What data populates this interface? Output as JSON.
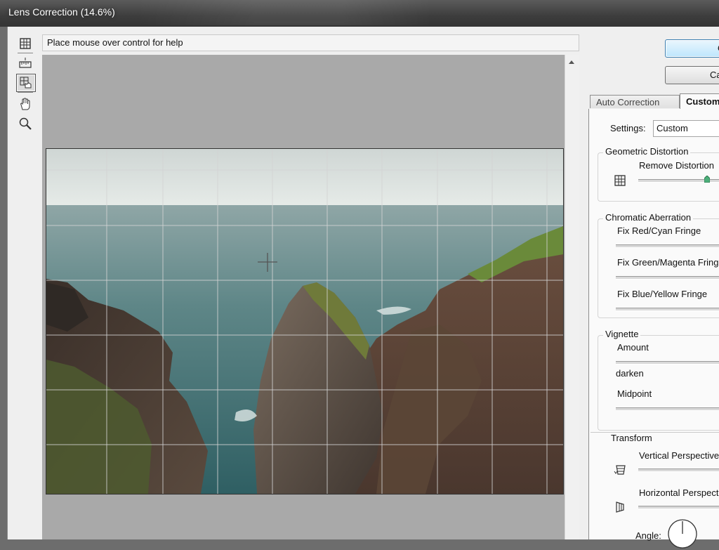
{
  "window": {
    "title": "Lens Correction (14.6%)"
  },
  "help": {
    "text": "Place mouse over control for help"
  },
  "tools": [
    {
      "name": "remove-distortion-tool-icon"
    },
    {
      "name": "straighten-tool-icon"
    },
    {
      "name": "move-grid-tool-icon",
      "selected": true
    },
    {
      "name": "hand-tool-icon"
    },
    {
      "name": "zoom-tool-icon"
    }
  ],
  "buttons": {
    "ok": "O",
    "cancel": "Ca"
  },
  "tabs": {
    "auto": "Auto Correction",
    "custom": "Custom"
  },
  "settings": {
    "label": "Settings:",
    "value": "Custom"
  },
  "geometric": {
    "legend": "Geometric Distortion",
    "remove_label": "Remove Distortion"
  },
  "chromatic": {
    "legend": "Chromatic Aberration",
    "red_cyan": "Fix Red/Cyan Fringe",
    "green_magenta": "Fix Green/Magenta Fringe",
    "blue_yellow": "Fix Blue/Yellow Fringe"
  },
  "vignette": {
    "legend": "Vignette",
    "amount": "Amount",
    "darken": "darken",
    "midpoint": "Midpoint"
  },
  "transform": {
    "legend": "Transform",
    "vertical": "Vertical Perspective",
    "horizontal": "Horizontal Perspective",
    "angle_label": "Angle:"
  },
  "colors": {
    "accent": "#3c7fb1",
    "slider_thumb": "#4caf7a"
  }
}
